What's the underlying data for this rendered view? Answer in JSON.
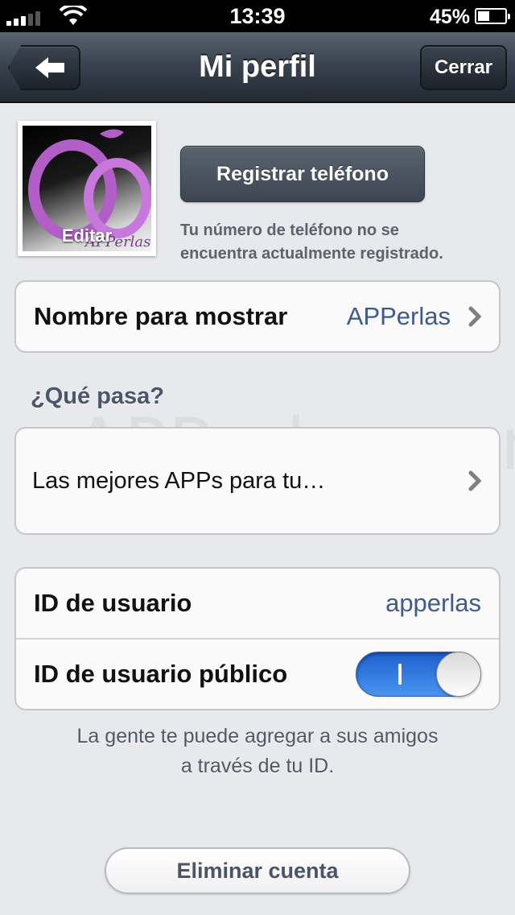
{
  "status_bar": {
    "time": "13:39",
    "battery_percent": "45%",
    "battery_level": 0.45,
    "signal_bars": 3
  },
  "nav": {
    "title": "Mi perfil",
    "close_label": "Cerrar",
    "back_icon": "back-arrow-icon"
  },
  "profile": {
    "avatar_edit_label": "Editar",
    "avatar_logo_text": "APPerlas"
  },
  "phone": {
    "register_label": "Registrar teléfono",
    "note_line1": "Tu número de teléfono no se",
    "note_line2": "encuentra actualmente registrado."
  },
  "display_name": {
    "label": "Nombre para mostrar",
    "value": "APPerlas"
  },
  "whats_up": {
    "header": "¿Qué pasa?",
    "status": "Las mejores APPs para tu…"
  },
  "user_id": {
    "label": "ID de usuario",
    "value": "apperlas",
    "public_label": "ID de usuario público",
    "public_enabled": true
  },
  "id_note": {
    "line1": "La gente te puede agregar a sus amigos",
    "line2": "a través de tu ID."
  },
  "delete_account_label": "Eliminar cuenta",
  "watermark": "APPerlas.com",
  "colors": {
    "nav_dark": "#232a33",
    "link_blue": "#3e5b8a",
    "toggle_blue": "#1e5fcf",
    "background": "#e8e9ec"
  }
}
